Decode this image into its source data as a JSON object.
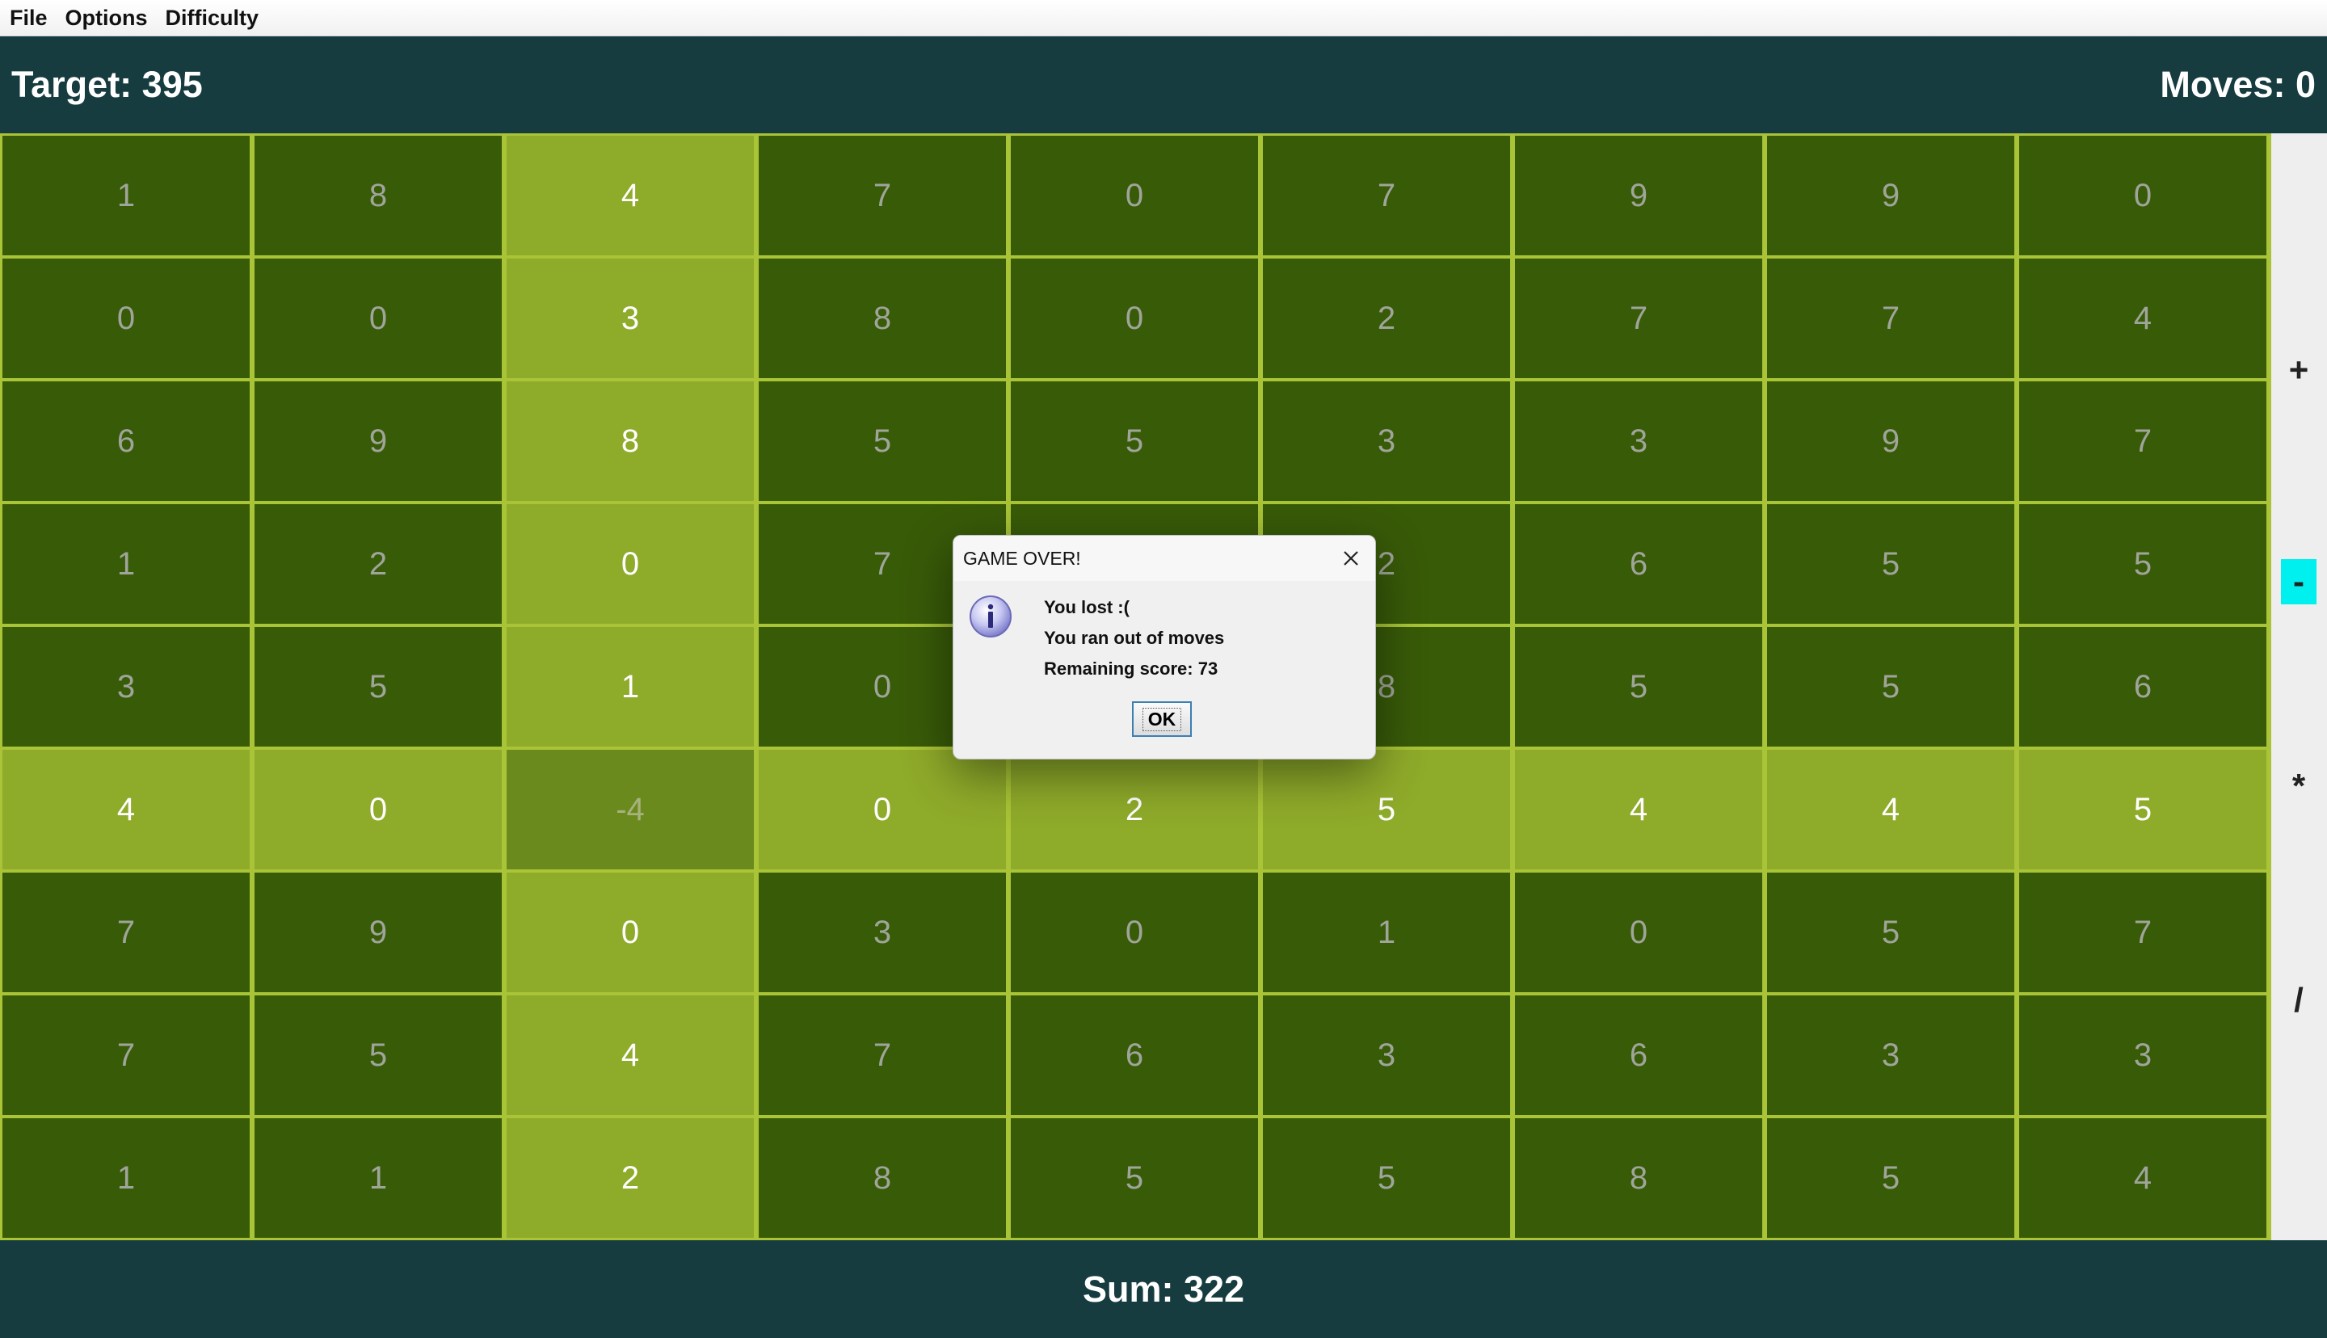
{
  "menu": {
    "items": [
      {
        "label": "File"
      },
      {
        "label": "Options"
      },
      {
        "label": "Difficulty"
      }
    ]
  },
  "header": {
    "target_label": "Target: 395",
    "moves_label": "Moves: 0"
  },
  "board": {
    "rows": 9,
    "cols": 9,
    "highlighted_row": 5,
    "highlighted_col": 2,
    "colors": {
      "cell": "#385b08",
      "highlight": "#8fab2a",
      "selected": "#6b8a1e",
      "grid_line": "#a9c436"
    },
    "cells": [
      [
        "1",
        "8",
        "4",
        "7",
        "0",
        "7",
        "9",
        "9",
        "0"
      ],
      [
        "0",
        "0",
        "3",
        "8",
        "0",
        "2",
        "7",
        "7",
        "4"
      ],
      [
        "6",
        "9",
        "8",
        "5",
        "5",
        "3",
        "3",
        "9",
        "7"
      ],
      [
        "1",
        "2",
        "0",
        "7",
        "",
        "2",
        "6",
        "5",
        "5"
      ],
      [
        "3",
        "5",
        "1",
        "0",
        "",
        "8",
        "5",
        "5",
        "6"
      ],
      [
        "4",
        "0",
        "-4",
        "0",
        "2",
        "5",
        "4",
        "4",
        "5"
      ],
      [
        "7",
        "9",
        "0",
        "3",
        "0",
        "1",
        "0",
        "5",
        "7"
      ],
      [
        "7",
        "5",
        "4",
        "7",
        "6",
        "3",
        "6",
        "3",
        "3"
      ],
      [
        "1",
        "1",
        "2",
        "8",
        "5",
        "5",
        "8",
        "5",
        "4"
      ]
    ]
  },
  "operators": {
    "items": [
      {
        "symbol": "+",
        "name": "add"
      },
      {
        "symbol": "-",
        "name": "subtract"
      },
      {
        "symbol": "*",
        "name": "multiply"
      },
      {
        "symbol": "/",
        "name": "divide"
      }
    ],
    "active": "-",
    "active_color": "#00f0f0"
  },
  "footer": {
    "sum_label": "Sum: 322"
  },
  "dialog": {
    "title": "GAME OVER!",
    "line1": "You lost :(",
    "line2": "You ran out of moves",
    "line3": "Remaining score: 73",
    "ok_label": "OK",
    "icon": "info-icon"
  },
  "theme": {
    "header_bg": "#163c40"
  }
}
